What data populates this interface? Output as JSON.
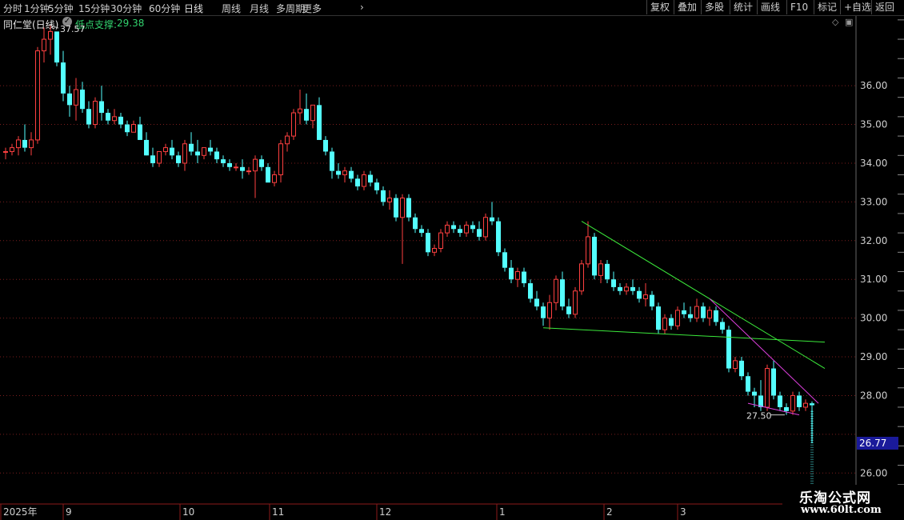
{
  "toolbar": {
    "periods": [
      "分时",
      "1分钟",
      "5分钟",
      "15分钟",
      "30分钟",
      "60分钟",
      "日线",
      "周线",
      "月线",
      "多周期",
      "更多"
    ],
    "active_period": "日线",
    "more_icon": "chevron-right-icon",
    "right_buttons": [
      "复权",
      "叠加",
      "多股",
      "统计",
      "画线",
      "F10",
      "标记",
      "+自选",
      "返回"
    ]
  },
  "info": {
    "title": "同仁堂(日线)",
    "indicator_label": "低点支撑:",
    "indicator_value": "29.38",
    "indicator_color": "#32d26e",
    "settings_icon": "gear-icon"
  },
  "brand": {
    "name": "乐淘公式网",
    "url": "www.60lt.com"
  },
  "colors": {
    "up": "#ff4040",
    "down": "#54ffff",
    "trend": "#3be83b",
    "wedge": "#e040e0",
    "grid": "#7a1d1d"
  },
  "chart_data": {
    "type": "candlestick",
    "y_ticks": [
      26,
      27,
      28,
      29,
      30,
      31,
      32,
      33,
      34,
      35,
      36
    ],
    "y_tick_labels": [
      "26.00",
      "28.00",
      "29.00",
      "30.00",
      "31.00",
      "32.00",
      "33.00",
      "34.00",
      "35.00",
      "36.00"
    ],
    "ylim": [
      25.2,
      37.8
    ],
    "last_price": "26.77",
    "high_label": "37.57",
    "low_label": "27.50",
    "x_labels": [
      "2025年",
      "9",
      "10",
      "11",
      "12",
      "1",
      "2",
      "3"
    ],
    "candles": [
      [
        34.3,
        34.4,
        34.1,
        34.3
      ],
      [
        34.3,
        34.5,
        34.2,
        34.4
      ],
      [
        34.4,
        34.7,
        34.2,
        34.6
      ],
      [
        34.6,
        35.0,
        34.3,
        34.4
      ],
      [
        34.4,
        34.8,
        34.2,
        34.6
      ],
      [
        34.6,
        37.0,
        34.5,
        36.9
      ],
      [
        36.9,
        37.5,
        36.6,
        37.2
      ],
      [
        37.2,
        37.57,
        36.8,
        37.4
      ],
      [
        37.4,
        37.3,
        36.5,
        36.6
      ],
      [
        36.6,
        36.9,
        35.6,
        35.8
      ],
      [
        35.8,
        36.0,
        35.2,
        35.5
      ],
      [
        35.5,
        36.2,
        35.1,
        35.9
      ],
      [
        35.9,
        36.1,
        35.3,
        35.4
      ],
      [
        35.4,
        35.6,
        34.9,
        35.0
      ],
      [
        35.0,
        35.7,
        34.9,
        35.6
      ],
      [
        35.6,
        36.0,
        35.1,
        35.3
      ],
      [
        35.3,
        35.4,
        35.0,
        35.1
      ],
      [
        35.1,
        35.4,
        35.0,
        35.2
      ],
      [
        35.2,
        35.3,
        34.9,
        35.0
      ],
      [
        35.0,
        35.1,
        34.7,
        34.8
      ],
      [
        34.8,
        35.1,
        34.8,
        35.0
      ],
      [
        35.0,
        35.2,
        34.6,
        34.6
      ],
      [
        34.6,
        34.8,
        34.2,
        34.2
      ],
      [
        34.2,
        34.4,
        33.9,
        34.0
      ],
      [
        34.0,
        34.3,
        33.9,
        34.3
      ],
      [
        34.3,
        34.5,
        34.2,
        34.4
      ],
      [
        34.4,
        34.6,
        34.1,
        34.2
      ],
      [
        34.2,
        34.3,
        33.9,
        34.0
      ],
      [
        34.0,
        34.6,
        33.8,
        34.5
      ],
      [
        34.5,
        34.8,
        34.2,
        34.3
      ],
      [
        34.3,
        34.6,
        34.0,
        34.2
      ],
      [
        34.2,
        34.4,
        34.1,
        34.4
      ],
      [
        34.4,
        34.6,
        34.2,
        34.3
      ],
      [
        34.3,
        34.4,
        34.0,
        34.1
      ],
      [
        34.1,
        34.2,
        33.9,
        34.0
      ],
      [
        34.0,
        34.1,
        33.8,
        33.9
      ],
      [
        33.9,
        34.0,
        33.8,
        33.9
      ],
      [
        33.9,
        34.1,
        33.6,
        33.8
      ],
      [
        33.8,
        33.9,
        33.7,
        33.8
      ],
      [
        33.8,
        34.2,
        33.1,
        34.1
      ],
      [
        34.1,
        34.2,
        33.8,
        33.9
      ],
      [
        33.9,
        34.0,
        33.5,
        33.5
      ],
      [
        33.5,
        33.8,
        33.4,
        33.7
      ],
      [
        33.7,
        34.6,
        33.5,
        34.5
      ],
      [
        34.5,
        34.8,
        34.3,
        34.7
      ],
      [
        34.7,
        35.4,
        34.6,
        35.3
      ],
      [
        35.3,
        35.9,
        35.0,
        35.4
      ],
      [
        35.4,
        35.8,
        35.0,
        35.1
      ],
      [
        35.1,
        35.5,
        34.9,
        35.5
      ],
      [
        35.5,
        35.7,
        34.6,
        34.6
      ],
      [
        34.6,
        34.7,
        34.2,
        34.3
      ],
      [
        34.3,
        34.4,
        33.6,
        33.8
      ],
      [
        33.8,
        34.0,
        33.6,
        33.7
      ],
      [
        33.7,
        33.9,
        33.5,
        33.8
      ],
      [
        33.8,
        33.9,
        33.5,
        33.6
      ],
      [
        33.6,
        33.7,
        33.3,
        33.4
      ],
      [
        33.4,
        33.8,
        33.3,
        33.7
      ],
      [
        33.7,
        33.8,
        33.4,
        33.5
      ],
      [
        33.5,
        33.6,
        33.2,
        33.3
      ],
      [
        33.3,
        33.4,
        32.9,
        33.0
      ],
      [
        33.0,
        33.3,
        32.8,
        33.1
      ],
      [
        33.1,
        33.2,
        32.5,
        32.6
      ],
      [
        32.6,
        33.2,
        31.4,
        33.1
      ],
      [
        33.1,
        33.2,
        32.5,
        32.6
      ],
      [
        32.6,
        32.7,
        32.2,
        32.3
      ],
      [
        32.3,
        32.4,
        32.1,
        32.2
      ],
      [
        32.2,
        32.3,
        31.6,
        31.7
      ],
      [
        31.7,
        31.9,
        31.6,
        31.8
      ],
      [
        31.8,
        32.3,
        31.7,
        32.2
      ],
      [
        32.2,
        32.5,
        32.1,
        32.4
      ],
      [
        32.4,
        32.5,
        32.2,
        32.3
      ],
      [
        32.3,
        32.4,
        32.1,
        32.2
      ],
      [
        32.2,
        32.5,
        32.1,
        32.4
      ],
      [
        32.4,
        32.5,
        32.2,
        32.3
      ],
      [
        32.3,
        32.5,
        32.0,
        32.1
      ],
      [
        32.1,
        32.7,
        32.0,
        32.6
      ],
      [
        32.6,
        33.0,
        32.4,
        32.5
      ],
      [
        32.5,
        32.6,
        31.6,
        31.7
      ],
      [
        31.7,
        31.8,
        31.2,
        31.3
      ],
      [
        31.3,
        31.5,
        30.9,
        31.0
      ],
      [
        31.0,
        31.3,
        30.8,
        31.2
      ],
      [
        31.2,
        31.3,
        30.8,
        30.9
      ],
      [
        30.9,
        31.0,
        30.4,
        30.5
      ],
      [
        30.5,
        30.7,
        30.2,
        30.3
      ],
      [
        30.3,
        30.4,
        29.8,
        30.0
      ],
      [
        30.0,
        30.6,
        29.7,
        30.4
      ],
      [
        30.4,
        31.1,
        30.2,
        31.0
      ],
      [
        31.0,
        31.2,
        30.2,
        30.3
      ],
      [
        30.3,
        30.5,
        30.0,
        30.1
      ],
      [
        30.1,
        30.8,
        30.0,
        30.7
      ],
      [
        30.7,
        31.5,
        30.6,
        31.4
      ],
      [
        31.4,
        32.5,
        31.3,
        32.1
      ],
      [
        32.1,
        32.2,
        31.0,
        31.1
      ],
      [
        31.1,
        31.5,
        30.9,
        31.4
      ],
      [
        31.4,
        31.5,
        30.9,
        31.0
      ],
      [
        31.0,
        31.2,
        30.7,
        30.8
      ],
      [
        30.8,
        30.9,
        30.6,
        30.7
      ],
      [
        30.7,
        30.9,
        30.6,
        30.8
      ],
      [
        30.8,
        31.0,
        30.6,
        30.7
      ],
      [
        30.7,
        30.8,
        30.4,
        30.5
      ],
      [
        30.5,
        30.9,
        30.3,
        30.6
      ],
      [
        30.6,
        30.7,
        30.2,
        30.3
      ],
      [
        30.3,
        30.4,
        29.6,
        29.7
      ],
      [
        29.7,
        30.1,
        29.6,
        30.0
      ],
      [
        30.0,
        30.1,
        29.7,
        29.8
      ],
      [
        29.8,
        30.3,
        29.7,
        30.2
      ],
      [
        30.2,
        30.4,
        30.0,
        30.1
      ],
      [
        30.1,
        30.3,
        29.9,
        30.0
      ],
      [
        30.0,
        30.5,
        29.9,
        30.3
      ],
      [
        30.3,
        30.4,
        29.9,
        30.0
      ],
      [
        30.0,
        30.3,
        29.8,
        30.2
      ],
      [
        30.2,
        30.3,
        29.8,
        29.9
      ],
      [
        29.9,
        30.0,
        29.6,
        29.7
      ],
      [
        29.7,
        29.8,
        28.6,
        28.7
      ],
      [
        28.7,
        29.0,
        28.6,
        28.9
      ],
      [
        28.9,
        29.0,
        28.4,
        28.5
      ],
      [
        28.5,
        28.6,
        28.0,
        28.1
      ],
      [
        28.1,
        28.2,
        27.7,
        28.0
      ],
      [
        28.0,
        28.4,
        27.6,
        27.7
      ],
      [
        27.7,
        28.8,
        27.6,
        28.7
      ],
      [
        28.7,
        28.9,
        27.9,
        28.0
      ],
      [
        28.0,
        28.1,
        27.6,
        27.7
      ],
      [
        27.7,
        27.8,
        27.5,
        27.6
      ],
      [
        27.6,
        28.1,
        27.5,
        28.0
      ],
      [
        28.0,
        28.1,
        27.6,
        27.7
      ],
      [
        27.7,
        27.9,
        27.6,
        27.8
      ],
      [
        27.8,
        27.85,
        26.77,
        27.75
      ]
    ],
    "lines": [
      {
        "color": "trend",
        "points": [
          [
            90,
            32.5
          ],
          [
            128,
            28.7
          ]
        ]
      },
      {
        "color": "trend",
        "points": [
          [
            84,
            29.75
          ],
          [
            128,
            29.38
          ]
        ]
      },
      {
        "color": "wedge",
        "points": [
          [
            110,
            30.5
          ],
          [
            127,
            27.8
          ]
        ]
      },
      {
        "color": "wedge",
        "points": [
          [
            116,
            27.8
          ],
          [
            124,
            27.5
          ]
        ]
      }
    ]
  }
}
